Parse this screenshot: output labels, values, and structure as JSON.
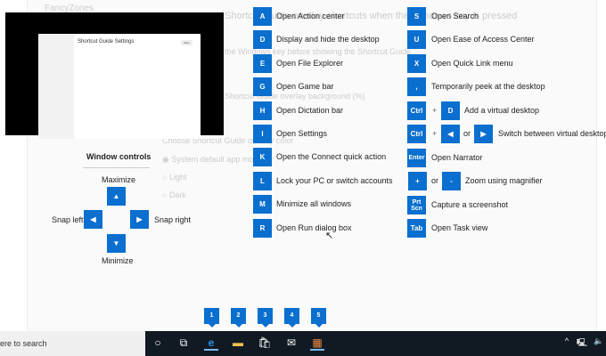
{
  "background": {
    "fancyzones": "FancyZones",
    "overlay_hint": "Shortcut Guide overlay shortcuts when the Windows key is pressed",
    "press_hint": "the Windows key before showing the Shortcut Guide",
    "opacity_hint": "Shortcut Guide overlay background (%)",
    "theme_hint": "Choose Shortcut Guide overlay color",
    "theme_options": [
      "System default app mode",
      "Light",
      "Dark"
    ]
  },
  "thumbnail": {
    "title": "Shortcut Guide Settings",
    "save": "Save"
  },
  "window_controls": {
    "title": "Window controls",
    "maximize": "Maximize",
    "snap_left": "Snap left",
    "snap_right": "Snap right",
    "minimize": "Minimize"
  },
  "shortcuts_left": [
    {
      "key": "A",
      "label": "Open Action center"
    },
    {
      "key": "D",
      "label": "Display and hide the desktop"
    },
    {
      "key": "E",
      "label": "Open File Explorer"
    },
    {
      "key": "G",
      "label": "Open Game bar"
    },
    {
      "key": "H",
      "label": "Open Dictation bar"
    },
    {
      "key": "I",
      "label": "Open Settings"
    },
    {
      "key": "K",
      "label": "Open the Connect quick action"
    },
    {
      "key": "L",
      "label": "Lock your PC or switch accounts"
    },
    {
      "key": "M",
      "label": "Minimize all windows"
    },
    {
      "key": "R",
      "label": "Open Run dialog box"
    }
  ],
  "shortcuts_right": {
    "s": {
      "key": "S",
      "label": "Open Search"
    },
    "u": {
      "key": "U",
      "label": "Open Ease of Access Center"
    },
    "x": {
      "key": "X",
      "label": "Open Quick Link menu"
    },
    "comma": {
      "key": ",",
      "label": "Temporarily peek at the desktop"
    },
    "add_desktop": {
      "key1": "Ctrl",
      "plus": "+",
      "key2": "D",
      "label": "Add a virtual desktop"
    },
    "switch_desktop": {
      "key1": "Ctrl",
      "plus": "+",
      "or": "or",
      "label": "Switch between virtual desktops"
    },
    "narrator": {
      "key": "Enter",
      "label": "Open Narrator"
    },
    "magnifier": {
      "key1": "+",
      "or": "or",
      "key2": "-",
      "label": "Zoom using magnifier"
    },
    "screenshot": {
      "key": "Prt Scn",
      "label": "Capture a screenshot"
    },
    "taskview": {
      "key": "Tab",
      "label": "Open Task view"
    }
  },
  "taskbar": {
    "search": "ere to search",
    "badges": [
      "1",
      "2",
      "3",
      "4",
      "5"
    ]
  },
  "colors": {
    "accent": "#0a6fcf",
    "taskbar": "#111a22"
  }
}
